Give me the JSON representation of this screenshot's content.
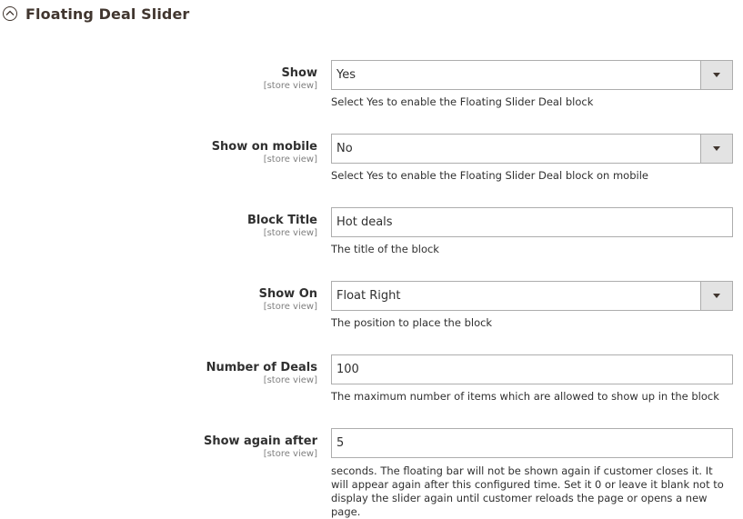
{
  "section": {
    "title": "Floating Deal Slider",
    "toggle_icon": "collapse-circle-up-icon"
  },
  "fields": [
    {
      "label": "Show",
      "scope": "[store view]",
      "type": "select",
      "value": "Yes",
      "note": "Select Yes to enable the Floating Slider Deal block"
    },
    {
      "label": "Show on mobile",
      "scope": "[store view]",
      "type": "select",
      "value": "No",
      "note": "Select Yes to enable the Floating Slider Deal block on mobile"
    },
    {
      "label": "Block Title",
      "scope": "[store view]",
      "type": "text",
      "value": "Hot deals",
      "note": "The title of the block"
    },
    {
      "label": "Show On",
      "scope": "[store view]",
      "type": "select",
      "value": "Float Right",
      "note": "The position to place the block"
    },
    {
      "label": "Number of Deals",
      "scope": "[store view]",
      "type": "text",
      "value": "100",
      "note": "The maximum number of items which are allowed to show up in the block"
    },
    {
      "label": "Show again after",
      "scope": "[store view]",
      "type": "text",
      "value": "5",
      "note": "seconds. The floating bar will not be shown again if customer closes it. It will appear again after this configured time. Set it 0 or leave it blank not to display the slider again until customer reloads the page or opens a new page."
    }
  ]
}
